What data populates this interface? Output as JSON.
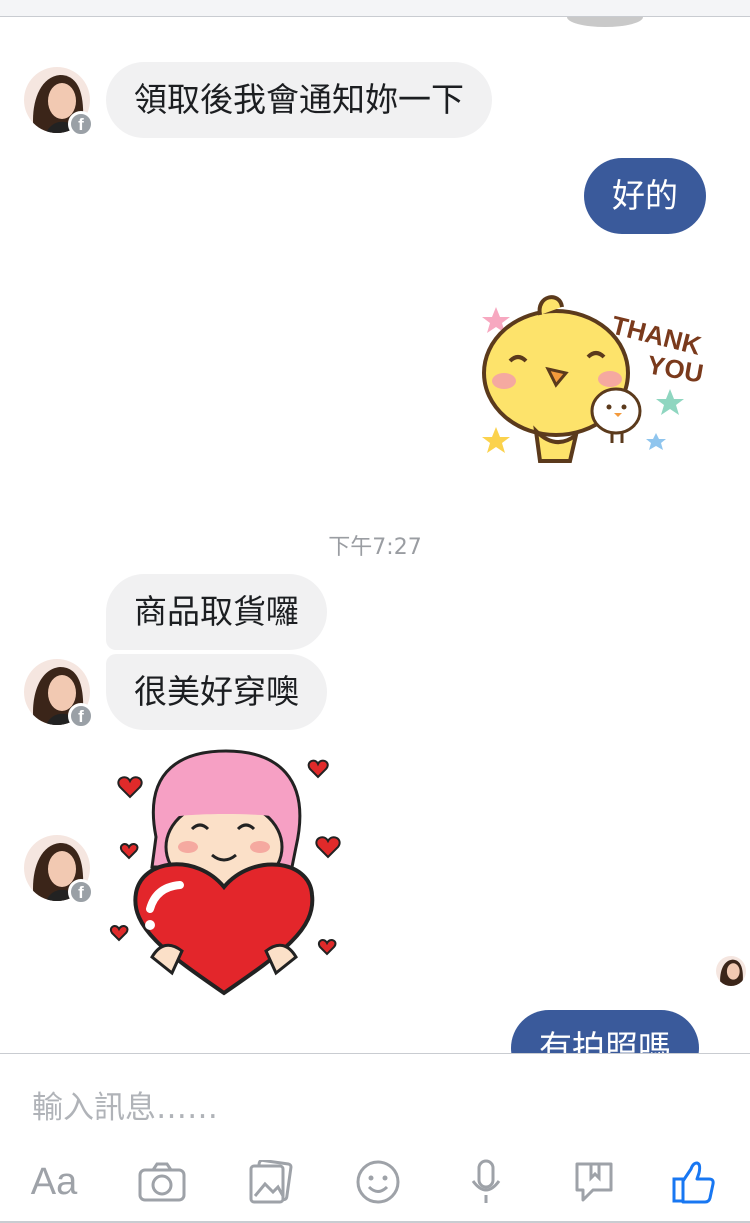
{
  "messages": {
    "m1": "領取後我會通知妳一下",
    "m2": "好的",
    "m3": "商品取貨囉",
    "m4": "很美好穿噢",
    "m5": "有拍照嗎"
  },
  "timestamp": "下午7:27",
  "stickers": {
    "thank_you_text_1": "THANK",
    "thank_you_text_2": "YOU"
  },
  "composer": {
    "placeholder": "輸入訊息……",
    "aa_label": "Aa"
  },
  "icons": {
    "fb_badge": "f",
    "text_format": "text-format-icon",
    "camera": "camera-icon",
    "gallery": "gallery-icon",
    "emoji": "emoji-icon",
    "mic": "microphone-icon",
    "sticker": "sticker-icon",
    "like": "like-icon"
  },
  "colors": {
    "outgoing_bubble": "#3a5a9b",
    "incoming_bubble": "#f1f1f2",
    "accent_blue": "#1877f2",
    "icon_gray": "#9ea2a8"
  }
}
